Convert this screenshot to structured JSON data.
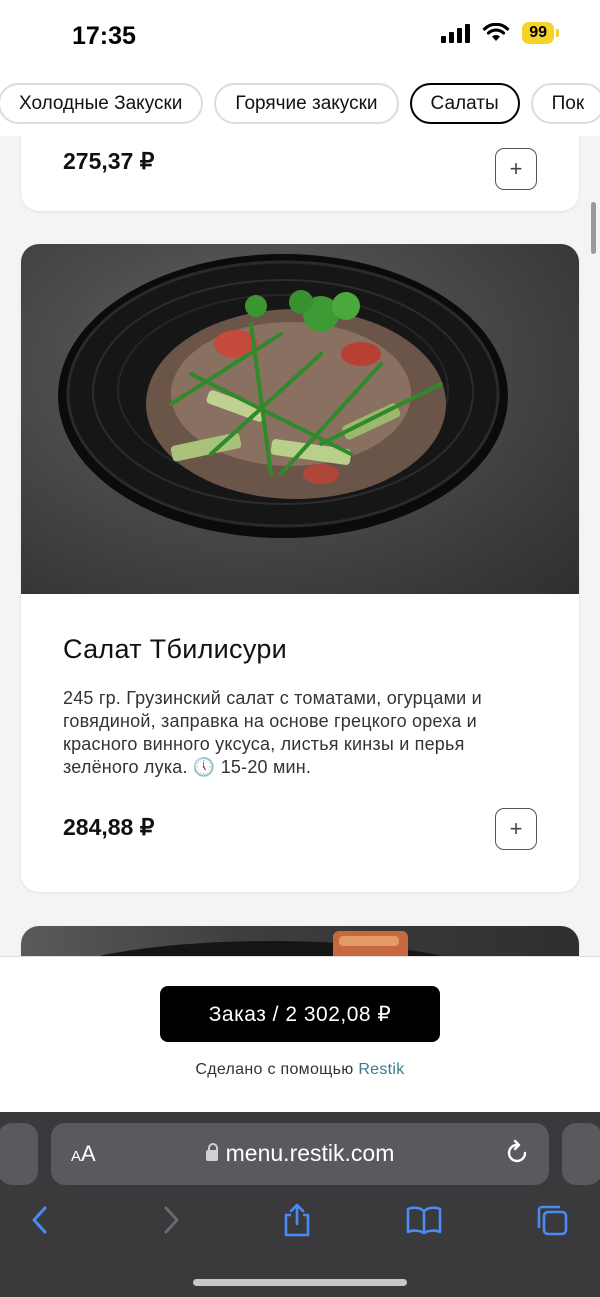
{
  "status": {
    "time": "17:35",
    "battery": "99",
    "battery_color": "#f6d22a"
  },
  "tabs": [
    {
      "label": "Холодные Закуски",
      "active": false
    },
    {
      "label": "Горячие закуски",
      "active": false
    },
    {
      "label": "Салаты",
      "active": true
    },
    {
      "label": "Пок",
      "active": false
    }
  ],
  "menu": {
    "prev_item": {
      "price": "275,37 ₽",
      "add_icon": "plus-icon"
    },
    "item": {
      "title": "Салат Тбилисури",
      "description": "245 гр. Грузинский салат с томатами, огурцами и говядиной, заправка на основе грецкого ореха и красного винного уксуса, листья кинзы и перья зелёного лука. 🕔 15-20 мин.",
      "price": "284,88 ₽",
      "add_icon": "plus-icon"
    }
  },
  "order": {
    "button_label": "Заказ / 2 302,08 ₽",
    "made_with_prefix": "Сделано с помощью",
    "made_with_link": "Restik",
    "link_color": "#3b7a8e"
  },
  "browser": {
    "text_size_label_small": "A",
    "text_size_label_big": "A",
    "url": "menu.restik.com",
    "accent": "#4a8af4"
  }
}
